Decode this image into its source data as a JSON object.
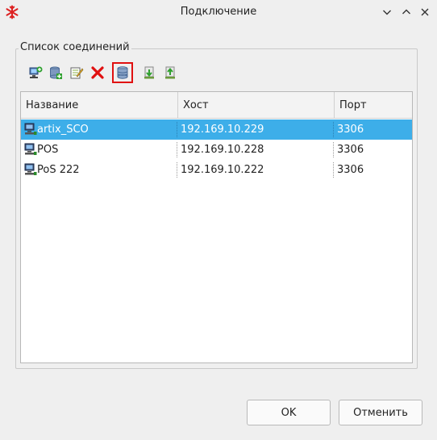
{
  "window": {
    "title": "Подключение",
    "app_icon": "snowflake-icon",
    "controls": [
      "chevron-down-icon",
      "chevron-up-icon",
      "close-icon"
    ]
  },
  "group": {
    "title": "Список соединений"
  },
  "toolbar": {
    "buttons": [
      {
        "name": "add-connection-icon"
      },
      {
        "name": "add-database-icon"
      },
      {
        "name": "edit-icon"
      },
      {
        "name": "delete-icon"
      },
      {
        "name": "database-settings-icon",
        "active": true
      },
      {
        "name": "import-icon"
      },
      {
        "name": "export-icon"
      }
    ]
  },
  "table": {
    "columns": [
      "Название",
      "Хост",
      "Порт"
    ],
    "rows": [
      {
        "name": "artix_SCO",
        "host": "192.169.10.229",
        "port": "3306",
        "selected": true
      },
      {
        "name": "POS",
        "host": "192.169.10.228",
        "port": "3306",
        "selected": false
      },
      {
        "name": "PoS 222",
        "host": "192.169.10.222",
        "port": "3306",
        "selected": false
      }
    ]
  },
  "buttons": {
    "ok": "OK",
    "cancel": "Отменить"
  },
  "colors": {
    "selection": "#3daee9",
    "delete": "#e01010",
    "active_outline": "#e01010"
  }
}
